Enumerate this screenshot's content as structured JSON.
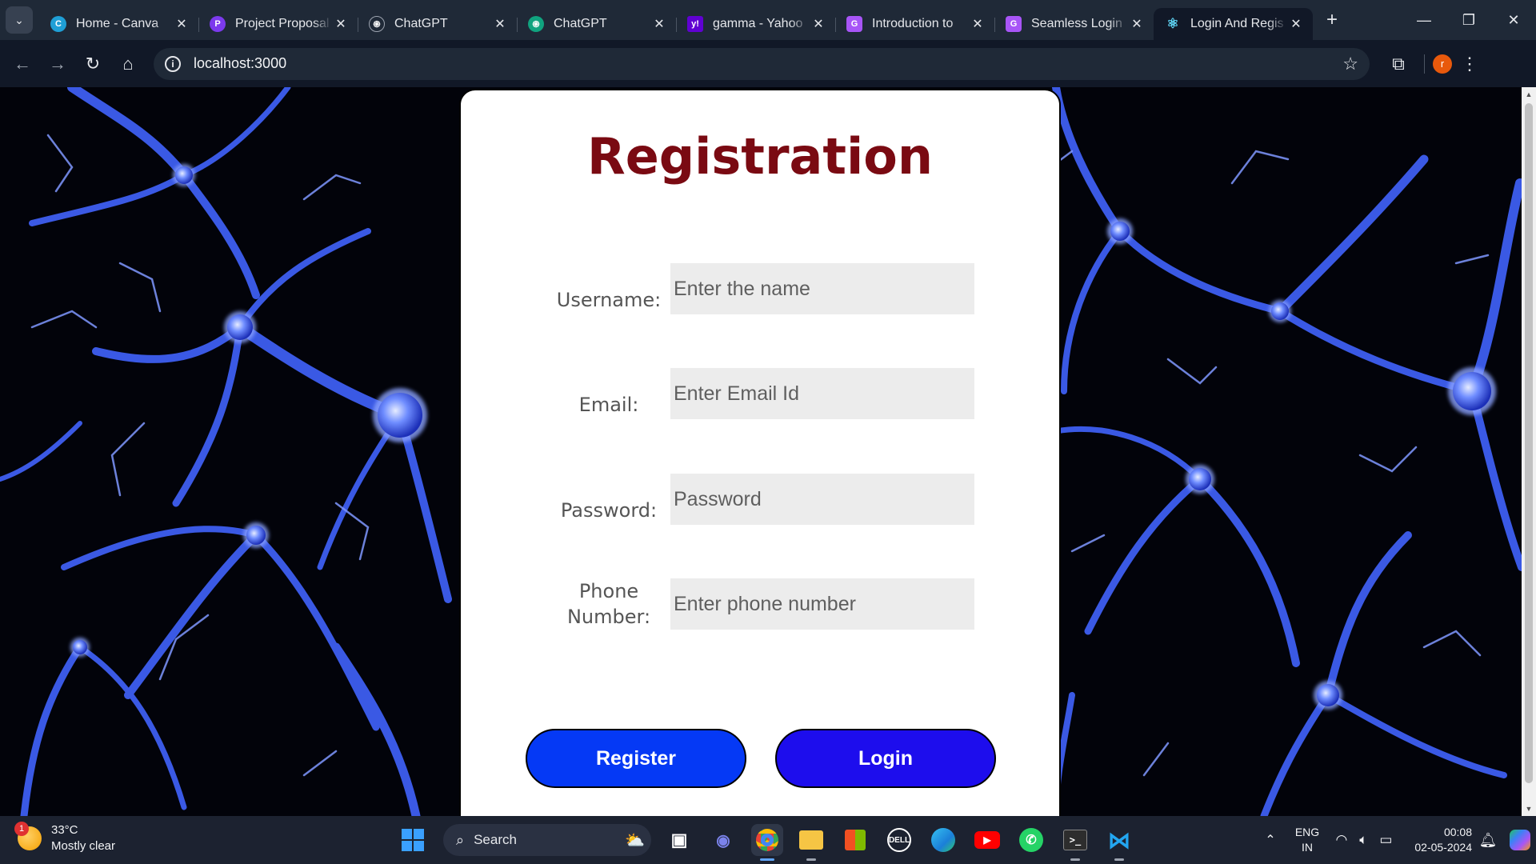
{
  "browser": {
    "tabs": [
      {
        "title": "Home - Canva",
        "favicon": "canva-icon",
        "color": "#1f9fd6",
        "glyph": "C",
        "active": false
      },
      {
        "title": "Project Proposal",
        "favicon": "canva-doc-icon",
        "color": "#7c3aed",
        "glyph": "P",
        "active": false
      },
      {
        "title": "ChatGPT",
        "favicon": "chatgpt-icon",
        "color": "#1f2937",
        "glyph": "֎",
        "active": false
      },
      {
        "title": "ChatGPT",
        "favicon": "chatgpt-icon",
        "color": "#10a37f",
        "glyph": "֎",
        "active": false
      },
      {
        "title": "gamma - Yahoo",
        "favicon": "yahoo-icon",
        "color": "#6001d2",
        "glyph": "y!",
        "active": false
      },
      {
        "title": "Introduction to",
        "favicon": "gamma-icon",
        "color": "#a855f7",
        "glyph": "G",
        "active": false
      },
      {
        "title": "Seamless Login",
        "favicon": "gamma-icon",
        "color": "#a855f7",
        "glyph": "G",
        "active": false
      },
      {
        "title": "Login And Regis",
        "favicon": "react-icon",
        "color": "#111827",
        "glyph": "⚛",
        "active": true
      }
    ],
    "url": "localhost:3000",
    "profile_initial": "r"
  },
  "form": {
    "title": "Registration",
    "fields": [
      {
        "label": "Username:",
        "placeholder": "Enter the name"
      },
      {
        "label": "Email:",
        "placeholder": "Enter Email Id"
      },
      {
        "label": "Password:",
        "placeholder": "Password"
      },
      {
        "label": "Phone Number:",
        "placeholder": "Enter phone number"
      }
    ],
    "register_label": "Register",
    "login_label": "Login",
    "colors": {
      "title": "#7a0a12",
      "register": "#0539f5",
      "login": "#1d0ded"
    }
  },
  "taskbar": {
    "weather": {
      "temp": "33°C",
      "desc": "Mostly clear",
      "badge": "1"
    },
    "search_label": "Search",
    "apps": [
      "task-view",
      "teams-meet",
      "chrome",
      "file-explorer",
      "microsoft-store",
      "dell",
      "edge",
      "youtube",
      "whatsapp",
      "terminal",
      "vscode"
    ],
    "lang": [
      "ENG",
      "IN"
    ],
    "time": "00:08",
    "date": "02-05-2024"
  }
}
